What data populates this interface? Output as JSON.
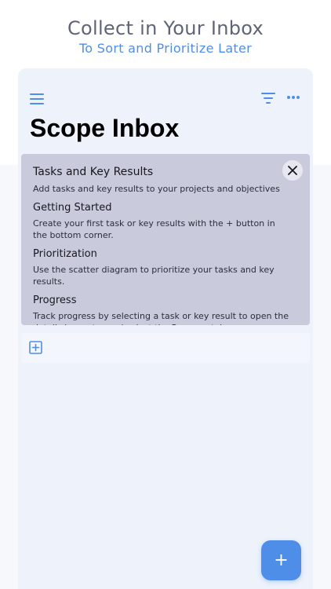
{
  "header": {
    "title": "Collect in Your Inbox",
    "subtitle": "To Sort and Prioritize Later"
  },
  "toolbar": {
    "menu_icon": "hamburger-menu-icon",
    "filter_icon": "filter-icon",
    "more_icon": "more-horizontal-icon"
  },
  "page": {
    "title": "Scope Inbox"
  },
  "help_card": {
    "title": "Tasks and Key Results",
    "text": "Add tasks and key results to your projects and objectives",
    "sections": [
      {
        "title": "Getting Started",
        "text": "Create your first task or key results with the + button in the bottom corner."
      },
      {
        "title": "Prioritization",
        "text": "Use the scatter diagram to prioritize your tasks and key results."
      },
      {
        "title": "Progress",
        "text": "Track progress by selecting a task or key result to open the details inspector and select the Progress tab."
      }
    ],
    "close_icon": "close-icon"
  },
  "add_row": {
    "icon": "plus-square-icon"
  },
  "fab": {
    "label": "+"
  },
  "colors": {
    "accent": "#4f8ee8",
    "card": "#c9cbdd",
    "background": "#edf2fb"
  }
}
